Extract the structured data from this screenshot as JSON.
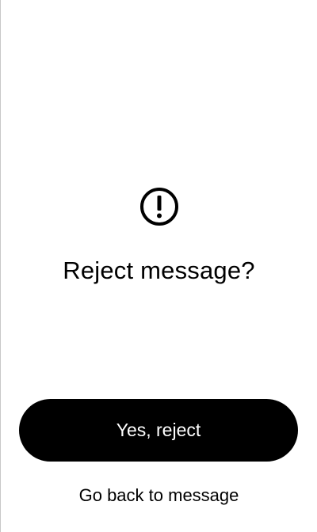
{
  "dialog": {
    "icon": "exclamation-circle-icon",
    "title": "Reject message?",
    "confirm_label": "Yes, reject",
    "back_label": "Go back to message"
  },
  "colors": {
    "background": "#ffffff",
    "text": "#000000",
    "button_background": "#000000",
    "button_text": "#ffffff"
  }
}
